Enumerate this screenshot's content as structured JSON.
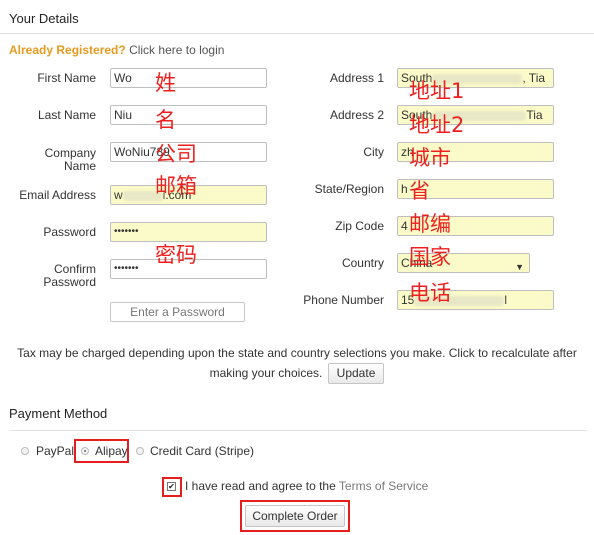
{
  "section_title": "Your Details",
  "registered": {
    "prompt": "Already Registered?",
    "link": "Click here to login"
  },
  "left_fields": {
    "first_name": {
      "label": "First Name",
      "value": "Wo",
      "annotation": "姓"
    },
    "last_name": {
      "label": "Last Name",
      "value": "Niu",
      "annotation": "名"
    },
    "company_name": {
      "label": "Company Name",
      "value": "WoNiu789",
      "annotation": "公司"
    },
    "email": {
      "label": "Email Address",
      "value_prefix": "w",
      "value_suffix": "i.com",
      "annotation": "邮箱"
    },
    "password": {
      "label": "Password",
      "value": "•••••••",
      "annotation": "密码"
    },
    "confirm_password": {
      "label": "Confirm Password",
      "value": "•••••••"
    }
  },
  "password_strength_button": "Enter a Password",
  "right_fields": {
    "address1": {
      "label": "Address 1",
      "value_prefix": "South",
      "value_suffix": ", Tia",
      "annotation": "地址1"
    },
    "address2": {
      "label": "Address 2",
      "value_prefix": "South",
      "value_suffix": "Tia",
      "annotation": "地址2"
    },
    "city": {
      "label": "City",
      "value": "zh",
      "annotation": "城市"
    },
    "state": {
      "label": "State/Region",
      "value": "h",
      "annotation": "省"
    },
    "zip": {
      "label": "Zip Code",
      "value": "4",
      "annotation": "邮编"
    },
    "country": {
      "label": "Country",
      "value": "China",
      "annotation": "国家"
    },
    "phone": {
      "label": "Phone Number",
      "value_prefix": "15",
      "value_suffix": "l",
      "annotation": "电话"
    }
  },
  "tax_note": "Tax may be charged depending upon the state and country selections you make. Click to recalculate after making your choices.",
  "update_button": "Update",
  "payment": {
    "title": "Payment Method",
    "options": [
      "PayPal",
      "Alipay",
      "Credit Card (Stripe)"
    ],
    "selected": "Alipay"
  },
  "terms": {
    "checked": true,
    "text": "I have read and agree to the",
    "link": "Terms of Service"
  },
  "complete_button": "Complete Order",
  "colors": {
    "accent_orange": "#e69a1f",
    "annotation_red": "#ee1f1f",
    "autofill_yellow": "#fbfbc9"
  }
}
